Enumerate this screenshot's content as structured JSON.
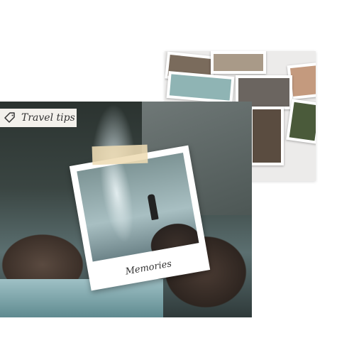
{
  "tag": {
    "icon": "tag-icon",
    "label": "Travel tips"
  },
  "polaroid": {
    "caption": "Memories"
  }
}
